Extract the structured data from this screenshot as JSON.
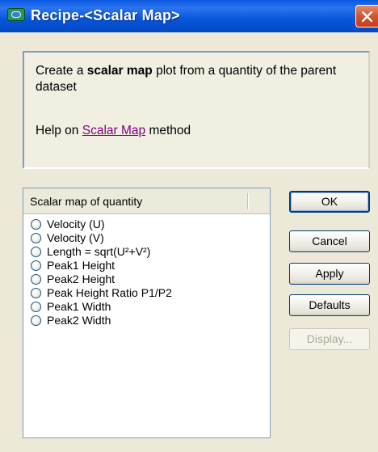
{
  "window": {
    "title": "Recipe-<Scalar Map>",
    "icon": "app-icon",
    "close_icon": "close-icon"
  },
  "description": {
    "prefix": "Create a ",
    "bold": "scalar map",
    "suffix": " plot from a quantity of the parent dataset",
    "help_prefix": "Help on ",
    "help_link": "Scalar Map",
    "help_suffix": " method"
  },
  "list": {
    "header": "Scalar map of quantity",
    "items": [
      {
        "label": "Velocity (U)",
        "selected": false
      },
      {
        "label": "Velocity (V)",
        "selected": false
      },
      {
        "label": "Length = sqrt(U²+V²)",
        "selected": false
      },
      {
        "label": "Peak1 Height",
        "selected": false
      },
      {
        "label": "Peak2 Height",
        "selected": false
      },
      {
        "label": "Peak Height Ratio P1/P2",
        "selected": false
      },
      {
        "label": "Peak1 Width",
        "selected": false
      },
      {
        "label": "Peak2 Width",
        "selected": false
      }
    ]
  },
  "buttons": {
    "ok": "OK",
    "cancel": "Cancel",
    "apply": "Apply",
    "defaults": "Defaults",
    "display": "Display..."
  },
  "colors": {
    "titlebar": "#0a58e0",
    "dialog_bg": "#ece9d8",
    "link": "#800080",
    "close": "#d4532f"
  }
}
